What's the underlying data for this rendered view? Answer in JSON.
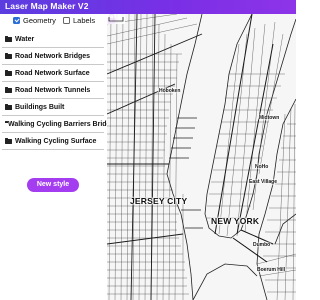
{
  "app": {
    "title": "Laser Map Maker V2"
  },
  "toggles": [
    {
      "label": "Geometry",
      "checked": true
    },
    {
      "label": "Labels",
      "checked": false
    }
  ],
  "layers": [
    {
      "label": "Water"
    },
    {
      "label": "Road Network Bridges"
    },
    {
      "label": "Road Network Surface"
    },
    {
      "label": "Road Network Tunnels"
    },
    {
      "label": "Buildings Built"
    },
    {
      "label": "Walking Cycling Barriers Bridges"
    },
    {
      "label": "Walking Cycling Surface"
    }
  ],
  "new_style_label": "New style",
  "map": {
    "places": {
      "jersey_city": "JERSEY CITY",
      "new_york": "NEW YORK",
      "noho": "NoHo",
      "east_village": "East Village",
      "dumbo": "Dumbo",
      "boerum_hill": "Boerum Hill",
      "midtown": "Midtown",
      "hoboken": "Hoboken"
    },
    "colors": {
      "accent": "#a43df0",
      "header": "#6a35e4",
      "road": "#222222",
      "water": "#f6f6f6"
    }
  }
}
